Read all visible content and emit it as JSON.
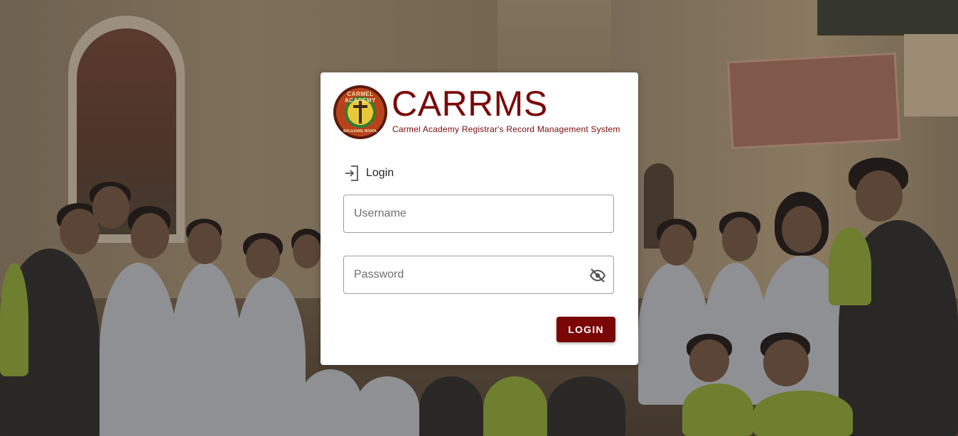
{
  "brand": {
    "title": "CARRMS",
    "subtitle": "Carmel Academy Registrar's Record Management System",
    "logo_ring_top": "CARMEL ACADEMY",
    "logo_ring_bottom": "BALILIHAN, BOHOL"
  },
  "login": {
    "heading": "Login",
    "heading_icon": "login-icon",
    "username_placeholder": "Username",
    "password_placeholder": "Password",
    "password_toggle_icon": "eye-off-icon",
    "submit_label": "LOGIN"
  },
  "colors": {
    "brand": "#7a0a0a",
    "button": "#7a0606"
  }
}
